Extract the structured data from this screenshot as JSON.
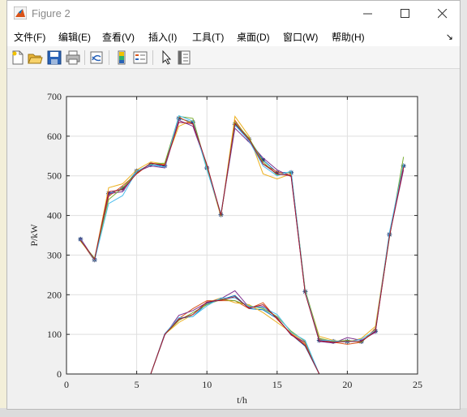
{
  "window": {
    "title": "Figure 2",
    "app_icon": "matlab-figure-icon",
    "controls": [
      "minimize-icon",
      "maximize-icon",
      "close-icon"
    ]
  },
  "menu": {
    "items": [
      {
        "label": "文件(F)"
      },
      {
        "label": "编辑(E)"
      },
      {
        "label": "查看(V)"
      },
      {
        "label": "插入(I)"
      },
      {
        "label": "工具(T)"
      },
      {
        "label": "桌面(D)"
      },
      {
        "label": "窗口(W)"
      },
      {
        "label": "帮助(H)"
      }
    ],
    "overflow_icon": "dock-arrow-icon"
  },
  "toolbar": {
    "buttons": [
      "new-figure-icon",
      "open-file-icon",
      "save-icon",
      "print-icon",
      "link-plot-icon",
      "insert-colorbar-icon",
      "insert-legend-icon",
      "edit-plot-arrow-icon",
      "property-inspector-icon"
    ]
  },
  "chart_data": {
    "type": "line",
    "title": "",
    "xlabel": "t/h",
    "ylabel": "P/kW",
    "xlim": [
      0,
      25
    ],
    "ylim": [
      0,
      700
    ],
    "xticks": [
      "0",
      "5",
      "10",
      "15",
      "20",
      "25"
    ],
    "yticks": [
      "0",
      "100",
      "200",
      "300",
      "400",
      "500",
      "600",
      "700"
    ],
    "grid": true,
    "colors": [
      "#0072BD",
      "#D95319",
      "#EDB120",
      "#7E2F8E",
      "#77AC30",
      "#4DBEEE",
      "#A2142F"
    ],
    "x": [
      1,
      2,
      3,
      4,
      5,
      6,
      7,
      8,
      9,
      10,
      11,
      12,
      13,
      14,
      15,
      16,
      17,
      18,
      19,
      20,
      21,
      22,
      23,
      24
    ],
    "series": [
      {
        "group": "load",
        "marker": "*",
        "values": [
          340,
          288,
          455,
          468,
          512,
          528,
          525,
          645,
          635,
          520,
          402,
          630,
          592,
          540,
          508,
          508,
          208,
          85,
          82,
          82,
          82,
          108,
          352,
          525
        ]
      },
      {
        "group": "load",
        "values": [
          338,
          285,
          448,
          475,
          505,
          532,
          528,
          648,
          630,
          522,
          400,
          640,
          590,
          530,
          510,
          502,
          205,
          88,
          80,
          75,
          80,
          115,
          350,
          520
        ]
      },
      {
        "group": "load",
        "values": [
          335,
          290,
          470,
          480,
          515,
          535,
          530,
          625,
          640,
          518,
          398,
          650,
          600,
          505,
          492,
          505,
          210,
          95,
          85,
          80,
          90,
          120,
          355,
          530
        ]
      },
      {
        "group": "load",
        "values": [
          342,
          288,
          455,
          460,
          510,
          525,
          520,
          640,
          625,
          525,
          402,
          620,
          585,
          545,
          515,
          498,
          206,
          82,
          78,
          92,
          85,
          105,
          350,
          515
        ]
      },
      {
        "group": "load",
        "values": [
          336,
          292,
          440,
          470,
          508,
          530,
          532,
          650,
          645,
          520,
          400,
          635,
          595,
          535,
          502,
          510,
          212,
          90,
          82,
          85,
          80,
          112,
          345,
          548
        ]
      },
      {
        "group": "load",
        "values": [
          340,
          286,
          430,
          450,
          512,
          528,
          522,
          652,
          638,
          515,
          404,
          628,
          588,
          525,
          500,
          512,
          208,
          86,
          84,
          80,
          88,
          110,
          358,
          530
        ]
      },
      {
        "group": "load",
        "values": [
          338,
          289,
          460,
          465,
          506,
          532,
          526,
          635,
          632,
          528,
          401,
          632,
          592,
          530,
          505,
          500,
          204,
          84,
          80,
          82,
          82,
          108,
          348,
          522
        ]
      },
      {
        "group": "pv",
        "values": [
          0,
          0,
          0,
          0,
          0,
          0,
          100,
          140,
          145,
          178,
          188,
          198,
          165,
          162,
          140,
          100,
          70,
          0,
          0,
          0,
          0,
          0,
          0,
          0
        ]
      },
      {
        "group": "pv",
        "values": [
          0,
          0,
          0,
          0,
          0,
          0,
          100,
          140,
          165,
          185,
          185,
          185,
          165,
          180,
          138,
          102,
          75,
          0,
          0,
          0,
          0,
          0,
          0,
          0
        ]
      },
      {
        "group": "pv",
        "values": [
          0,
          0,
          0,
          0,
          0,
          0,
          100,
          130,
          150,
          180,
          192,
          180,
          175,
          155,
          130,
          105,
          78,
          0,
          0,
          0,
          0,
          0,
          0,
          0
        ]
      },
      {
        "group": "pv",
        "values": [
          0,
          0,
          0,
          0,
          0,
          0,
          98,
          148,
          160,
          180,
          190,
          210,
          168,
          170,
          142,
          98,
          80,
          0,
          0,
          0,
          0,
          0,
          0,
          0
        ]
      },
      {
        "group": "pv",
        "values": [
          0,
          0,
          0,
          0,
          0,
          0,
          100,
          135,
          155,
          175,
          188,
          185,
          172,
          165,
          145,
          108,
          82,
          0,
          0,
          0,
          0,
          0,
          0,
          0
        ]
      },
      {
        "group": "pv",
        "values": [
          0,
          0,
          0,
          0,
          0,
          0,
          102,
          142,
          145,
          172,
          192,
          192,
          170,
          168,
          150,
          105,
          85,
          0,
          0,
          0,
          0,
          0,
          0,
          0
        ]
      },
      {
        "group": "pv",
        "values": [
          0,
          0,
          0,
          0,
          0,
          0,
          100,
          138,
          150,
          182,
          186,
          195,
          166,
          175,
          140,
          100,
          72,
          0,
          0,
          0,
          0,
          0,
          0,
          0
        ]
      }
    ]
  }
}
